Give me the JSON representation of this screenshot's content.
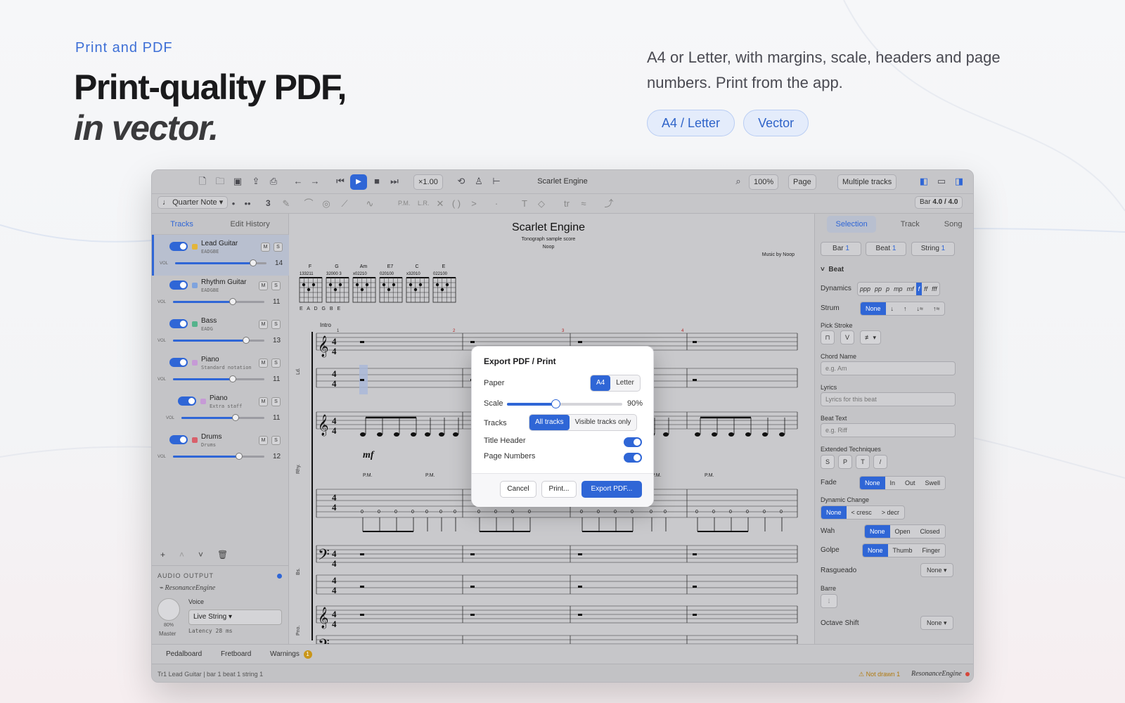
{
  "hero": {
    "eyebrow": "Print and PDF",
    "title_line1": "Print-quality PDF,",
    "title_line2": "in vector.",
    "description": "A4 or Letter, with margins, scale, headers and page numbers. Print from the app.",
    "pills": [
      "A4 / Letter",
      "Vector"
    ]
  },
  "toolbar": {
    "speed": "×1.00",
    "title": "Scarlet Engine",
    "zoom": "100%",
    "view_mode": "Page",
    "tracks_mode": "Multiple tracks",
    "note_value": "Quarter Note",
    "tuplet": "3",
    "bar_label": "Bar",
    "bar_value": "4.0 / 4.0",
    "pm_label": "P.M.",
    "lr_label": "L.R."
  },
  "left_panel": {
    "tabs": [
      "Tracks",
      "Edit History"
    ],
    "tracks": [
      {
        "name": "Lead Guitar",
        "tuning": "EADGBE",
        "volume": "14",
        "color": "#e3b53a"
      },
      {
        "name": "Rhythm Guitar",
        "tuning": "EADGBE",
        "volume": "11",
        "color": "#7fa3dd"
      },
      {
        "name": "Bass",
        "tuning": "EADG",
        "volume": "13",
        "color": "#55b38c"
      },
      {
        "name": "Piano",
        "tuning": "Standard notation",
        "volume": "11",
        "color": "#c69ad6"
      },
      {
        "name": "Piano",
        "tuning": "Extra staff",
        "volume": "11",
        "color": "#c69ad6"
      },
      {
        "name": "Drums",
        "tuning": "Drums",
        "volume": "12",
        "color": "#d8606b"
      }
    ],
    "vol_label": "VOL",
    "mute": "M",
    "solo": "S",
    "audio": {
      "title": "AUDIO OUTPUT",
      "engine": "ResonanceEngine",
      "voice_label": "Voice",
      "voice": "Live String",
      "latency": "Latency 28 ms",
      "percent": "80%",
      "master": "Master"
    }
  },
  "score": {
    "title": "Scarlet Engine",
    "subtitle": "Tonograph sample score",
    "author": "Noop",
    "music_by": "Music by Noop",
    "chords": [
      "F",
      "G",
      "Am",
      "E7",
      "C",
      "E"
    ],
    "chord_fingerings": [
      "133211",
      "32000 3",
      "x02210",
      "020100",
      "x32010",
      "022100"
    ],
    "tuning": "E A D G B E",
    "section": "Intro",
    "dynamic": "mf",
    "track_labels": [
      "Ld.",
      "Rhy.",
      "Bs.",
      "Pno."
    ],
    "pm": "P.M."
  },
  "right_panel": {
    "tabs": [
      "Selection",
      "Track",
      "Song"
    ],
    "bar": "Bar",
    "bar_num": "1",
    "beat": "Beat",
    "beat_num": "1",
    "string": "String",
    "string_num": "1",
    "section": "Beat",
    "dynamics_label": "Dynamics",
    "dynamics": [
      "ppp",
      "pp",
      "p",
      "mp",
      "mf",
      "f",
      "ff",
      "fff"
    ],
    "strum_label": "Strum",
    "strum": [
      "None",
      "↓",
      "↑",
      "↓≈",
      "↑≈"
    ],
    "pick_label": "Pick Stroke",
    "chord_label": "Chord Name",
    "chord_placeholder": "e.g. Am",
    "lyrics_label": "Lyrics",
    "lyrics_placeholder": "Lyrics for this beat",
    "beat_text_label": "Beat Text",
    "beat_text_placeholder": "e.g. Riff",
    "ext_label": "Extended Techniques",
    "ext": [
      "S",
      "P",
      "T",
      "/"
    ],
    "fade_label": "Fade",
    "fade": [
      "None",
      "In",
      "Out",
      "Swell"
    ],
    "dyn_change_label": "Dynamic Change",
    "dyn_change": [
      "None",
      "< cresc",
      "> decr"
    ],
    "wah_label": "Wah",
    "wah": [
      "None",
      "Open",
      "Closed"
    ],
    "golpe_label": "Golpe",
    "golpe": [
      "None",
      "Thumb",
      "Finger"
    ],
    "rasgueado_label": "Rasgueado",
    "rasgueado": "None",
    "barre_label": "Barre",
    "octave_label": "Octave Shift",
    "octave": "None"
  },
  "bottom": {
    "tabs": [
      "Pedalboard",
      "Fretboard",
      "Warnings"
    ],
    "warnings_count": "1",
    "status": "Tr1 Lead Guitar | bar 1 beat 1 string 1",
    "not_drawn": "Not drawn 1",
    "engine": "ResonanceEngine"
  },
  "modal": {
    "title": "Export PDF / Print",
    "paper_label": "Paper",
    "paper_options": [
      "A4",
      "Letter"
    ],
    "scale_label": "Scale",
    "scale_value": "90%",
    "scale_fraction": 0.42,
    "tracks_label": "Tracks",
    "tracks_options": [
      "All tracks",
      "Visible tracks only"
    ],
    "title_header_label": "Title Header",
    "page_numbers_label": "Page Numbers",
    "cancel": "Cancel",
    "print": "Print...",
    "export": "Export PDF..."
  },
  "colors": {
    "accent": "#2f66d6",
    "hero_eyebrow": "#3d6fd6",
    "pill_bg": "#e4ecfb"
  }
}
